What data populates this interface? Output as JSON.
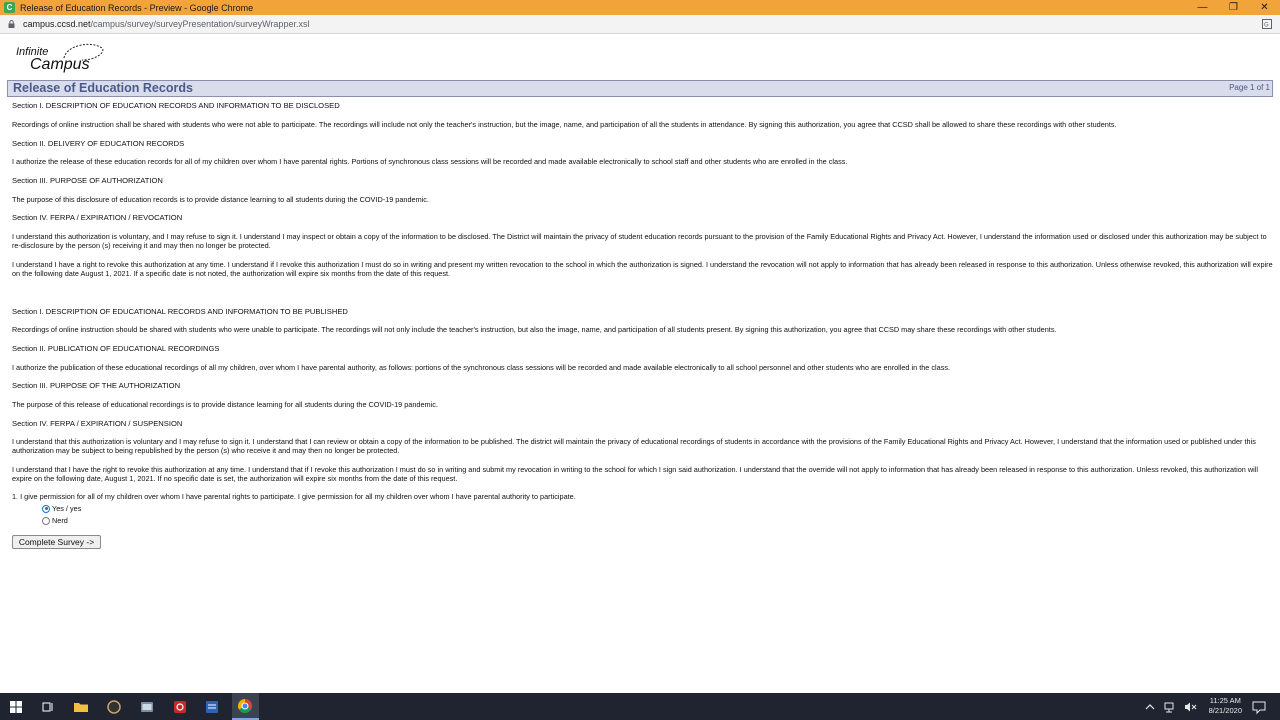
{
  "browser": {
    "window_title": "Release of Education Records - Preview - Google Chrome",
    "url_host": "campus.ccsd.net",
    "url_path": "/campus/survey/surveyPresentation/surveyWrapper.xsl",
    "controls": {
      "minimize": "—",
      "restore": "❐",
      "close": "✕"
    }
  },
  "logo": {
    "line1": "Infinite",
    "line2": "Campus"
  },
  "header": {
    "title": "Release of Education Records",
    "page": "Page 1 of 1"
  },
  "sections": [
    {
      "heading": "Section I. DESCRIPTION OF EDUCATION RECORDS AND INFORMATION TO BE DISCLOSED",
      "body": "Recordings of online instruction shall be shared with students who were not able to participate. The recordings will include not only the teacher's instruction, but the image, name, and participation of all the students in attendance. By signing this authorization, you agree that CCSD shall be allowed to share these recordings with other students."
    },
    {
      "heading": "Section II. DELIVERY OF EDUCATION RECORDS",
      "body": "I authorize the release of these education records for all of my children over whom I have parental rights. Portions of synchronous class sessions will be recorded and made available electronically to school staff and other students who are enrolled in the class."
    },
    {
      "heading": "Section III. PURPOSE OF AUTHORIZATION",
      "body": "The purpose of this disclosure of education records is to provide distance learning to all students during the COVID-19 pandemic."
    },
    {
      "heading": "Section IV. FERPA / EXPIRATION / REVOCATION",
      "body": "I understand this authorization is voluntary, and I may refuse to sign it. I understand I may inspect or obtain a copy of the information to be disclosed. The District will maintain the privacy of student education records pursuant to the provision of the Family Educational Rights and Privacy Act. However, I understand the information used or disclosed under this authorization may be subject to re-disclosure by the person (s) receiving it and may then no longer be protected.",
      "body2": "I understand I have a right to revoke this authorization at any time. I understand if I revoke this authorization I must do so in writing and present my written revocation to the school in which the authorization is signed. I understand the revocation will not apply to information that has already been released in response to this authorization. Unless otherwise revoked, this authorization will expire on the following date August 1, 2021. If a specific date is not noted, the authorization will expire six months from the date of this request."
    },
    {
      "heading": "Section I. DESCRIPTION OF EDUCATIONAL RECORDS AND INFORMATION TO BE PUBLISHED",
      "body": "Recordings of online instruction should be shared with students who were unable to participate. The recordings will not only include the teacher's instruction, but also the image, name, and participation of all students present. By signing this authorization, you agree that CCSD may share these recordings with other students."
    },
    {
      "heading": "Section II. PUBLICATION OF EDUCATIONAL RECORDINGS",
      "body": "I authorize the publication of these educational recordings of all my children, over whom I have parental authority, as follows: portions of the synchronous class sessions will be recorded and made available electronically to all school personnel and other students who are enrolled in the class."
    },
    {
      "heading": "Section III. PURPOSE OF THE AUTHORIZATION",
      "body": "The purpose of this release of educational recordings is to provide distance learning for all students during the COVID-19 pandemic."
    },
    {
      "heading": "Section IV. FERPA / EXPIRATION / SUSPENSION",
      "body": "I understand that this authorization is voluntary and I may refuse to sign it. I understand that I can review or obtain a copy of the information to be published. The district will maintain the privacy of educational recordings of students in accordance with the provisions of the Family Educational Rights and Privacy Act. However, I understand that the information used or published under this authorization may be subject to being republished by the person (s) who receive it and may then no longer be protected.",
      "body2": "I understand that I have the right to revoke this authorization at any time. I understand that if I revoke this authorization I must do so in writing and submit my revocation in writing to the school for which I sign said authorization. I understand that the override will not apply to information that has already been released in response to this authorization. Unless revoked, this authorization will expire on the following date, August 1, 2021. If no specific date is set, the authorization will expire six months from the date of this request."
    }
  ],
  "question": {
    "text": "1. I give permission for all of my children over whom I have parental rights to participate. I give permission for all my children over whom I have parental authority to participate.",
    "options": [
      "Yes / yes",
      "Nerd"
    ],
    "selected": "Yes / yes"
  },
  "submit_label": "Complete Survey ->",
  "taskbar": {
    "time": "11:25 AM",
    "date": "8/21/2020",
    "apps": [
      "windows-start",
      "task-view",
      "file-explorer",
      "app-circle",
      "app-window",
      "app-red",
      "app-notes",
      "chrome"
    ]
  },
  "colors": {
    "titlebar": "#f2a33a",
    "header_band": "#d9dcea",
    "header_text": "#4b5a8c",
    "taskbar": "#1f2430"
  }
}
